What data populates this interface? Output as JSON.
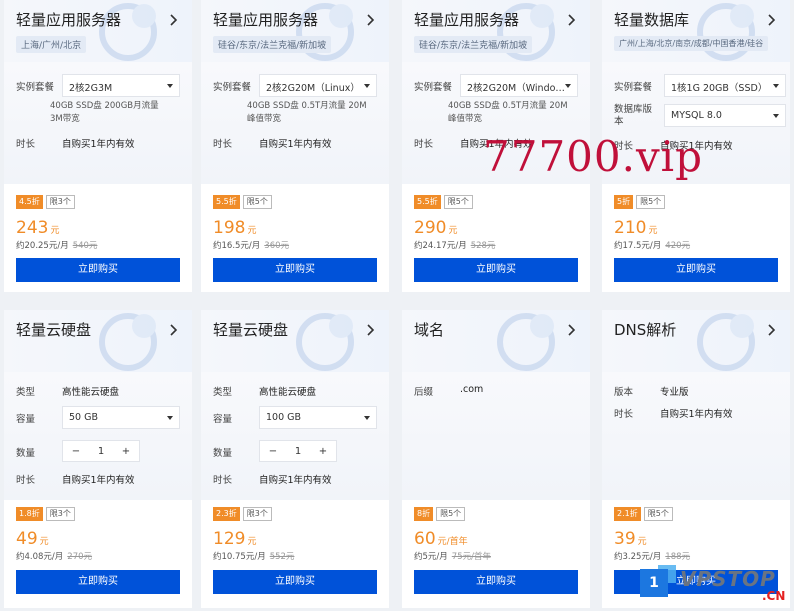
{
  "cards": [
    {
      "title": "轻量应用服务器",
      "region": "上海/广州/北京",
      "spec_label": "实例套餐",
      "spec_value": "2核2G3M",
      "spec_note": "40GB SSD盘 200GB月流量 3M带宽",
      "duration_label": "时长",
      "duration_value": "自购买1年内有效",
      "discount": "4.5折",
      "limit": "限3个",
      "price": "243",
      "unit": "元",
      "monthly": "约20.25元/月",
      "original": "540元",
      "buy": "立即购买"
    },
    {
      "title": "轻量应用服务器",
      "region": "硅谷/东京/法兰克福/新加坡",
      "spec_label": "实例套餐",
      "spec_value": "2核2G20M（Linux）",
      "spec_note": "40GB SSD盘 0.5T月流量 20M峰值带宽",
      "duration_label": "时长",
      "duration_value": "自购买1年内有效",
      "discount": "5.5折",
      "limit": "限5个",
      "price": "198",
      "unit": "元",
      "monthly": "约16.5元/月",
      "original": "360元",
      "buy": "立即购买"
    },
    {
      "title": "轻量应用服务器",
      "region": "硅谷/东京/法兰克福/新加坡",
      "spec_label": "实例套餐",
      "spec_value": "2核2G20M（Windo…",
      "spec_note": "40GB SSD盘 0.5T月流量 20M峰值带宽",
      "duration_label": "时长",
      "duration_value": "自购买1年内有效",
      "discount": "5.5折",
      "limit": "限5个",
      "price": "290",
      "unit": "元",
      "monthly": "约24.17元/月",
      "original": "528元",
      "buy": "立即购买"
    },
    {
      "title": "轻量数据库",
      "region": "广州/上海/北京/南京/成都/中国香港/硅谷",
      "spec_label": "实例套餐",
      "spec_value": "1核1G 20GB（SSD）",
      "version_label": "数据库版本",
      "version_value": "MYSQL 8.0",
      "duration_label": "时长",
      "duration_value": "自购买1年内有效",
      "discount": "5折",
      "limit": "限5个",
      "price": "210",
      "unit": "元",
      "monthly": "约17.5元/月",
      "original": "420元",
      "buy": "立即购买"
    },
    {
      "title": "轻量云硬盘",
      "type_label": "类型",
      "type_value": "高性能云硬盘",
      "capacity_label": "容量",
      "capacity_value": "50 GB",
      "qty_label": "数量",
      "qty_value": "1",
      "minus": "−",
      "plus": "+",
      "duration_label": "时长",
      "duration_value": "自购买1年内有效",
      "discount": "1.8折",
      "limit": "限3个",
      "price": "49",
      "unit": "元",
      "monthly": "约4.08元/月",
      "original": "270元",
      "buy": "立即购买"
    },
    {
      "title": "轻量云硬盘",
      "type_label": "类型",
      "type_value": "高性能云硬盘",
      "capacity_label": "容量",
      "capacity_value": "100 GB",
      "qty_label": "数量",
      "qty_value": "1",
      "minus": "−",
      "plus": "+",
      "duration_label": "时长",
      "duration_value": "自购买1年内有效",
      "discount": "2.3折",
      "limit": "限3个",
      "price": "129",
      "unit": "元",
      "monthly": "约10.75元/月",
      "original": "552元",
      "buy": "立即购买"
    },
    {
      "title": "域名",
      "suffix_label": "后缀",
      "suffix_value": ".com",
      "discount": "8折",
      "limit": "限5个",
      "price": "60",
      "unit": "元/首年",
      "monthly": "约5元/月",
      "original": "75元/首年",
      "buy": "立即购买"
    },
    {
      "title": "DNS解析",
      "version_label": "版本",
      "version_value": "专业版",
      "duration_label": "时长",
      "duration_value": "自购买1年内有效",
      "discount": "2.1折",
      "limit": "限5个",
      "price": "39",
      "unit": "元",
      "monthly": "约3.25元/月",
      "original": "188元",
      "buy": "立即购买"
    }
  ],
  "watermark": "77700.vip",
  "logo": {
    "badge": "1",
    "text": "VPSTOP",
    "suffix": ".CN"
  },
  "colors": {
    "accent": "#f08c28",
    "button": "#0052d9",
    "watermark": "#c0103a"
  },
  "icons": {
    "chevron": "chevron-right-icon",
    "caret": "caret-down-icon"
  }
}
